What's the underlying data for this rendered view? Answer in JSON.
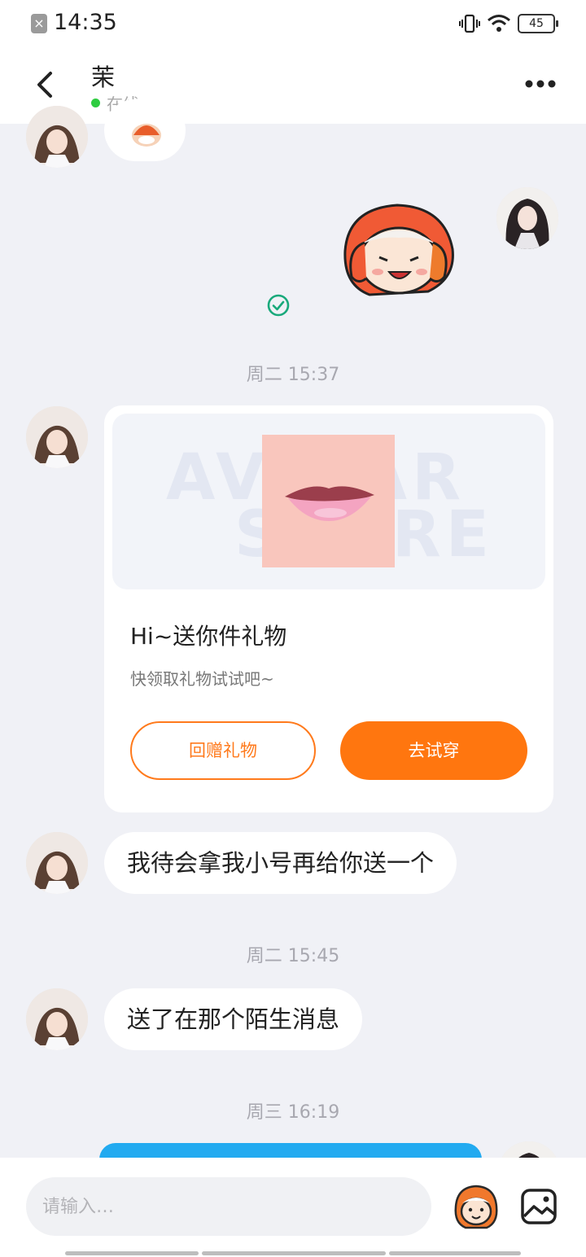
{
  "status_bar": {
    "time": "14:35",
    "battery": "45"
  },
  "header": {
    "contact_name": "茉",
    "online_status": "在线"
  },
  "messages": {
    "time_1": "周二 15:37",
    "gift_card": {
      "watermark_line1": "AVATAR",
      "watermark_line2": "STORE",
      "title": "Hi~送你件礼物",
      "subtitle": "快领取礼物试试吧~",
      "return_gift_label": "回赠礼物",
      "try_on_label": "去试穿"
    },
    "msg_1": "我待会拿我小号再给你送一个",
    "time_2": "周二 15:45",
    "msg_2": "送了在那个陌生消息",
    "time_3": "周三 16:19"
  },
  "input_bar": {
    "placeholder": "请输入…"
  },
  "colors": {
    "accent": "#ff760f",
    "online": "#2ecc40",
    "sent_bubble": "#22aaf0",
    "read_check": "#19a97b"
  }
}
